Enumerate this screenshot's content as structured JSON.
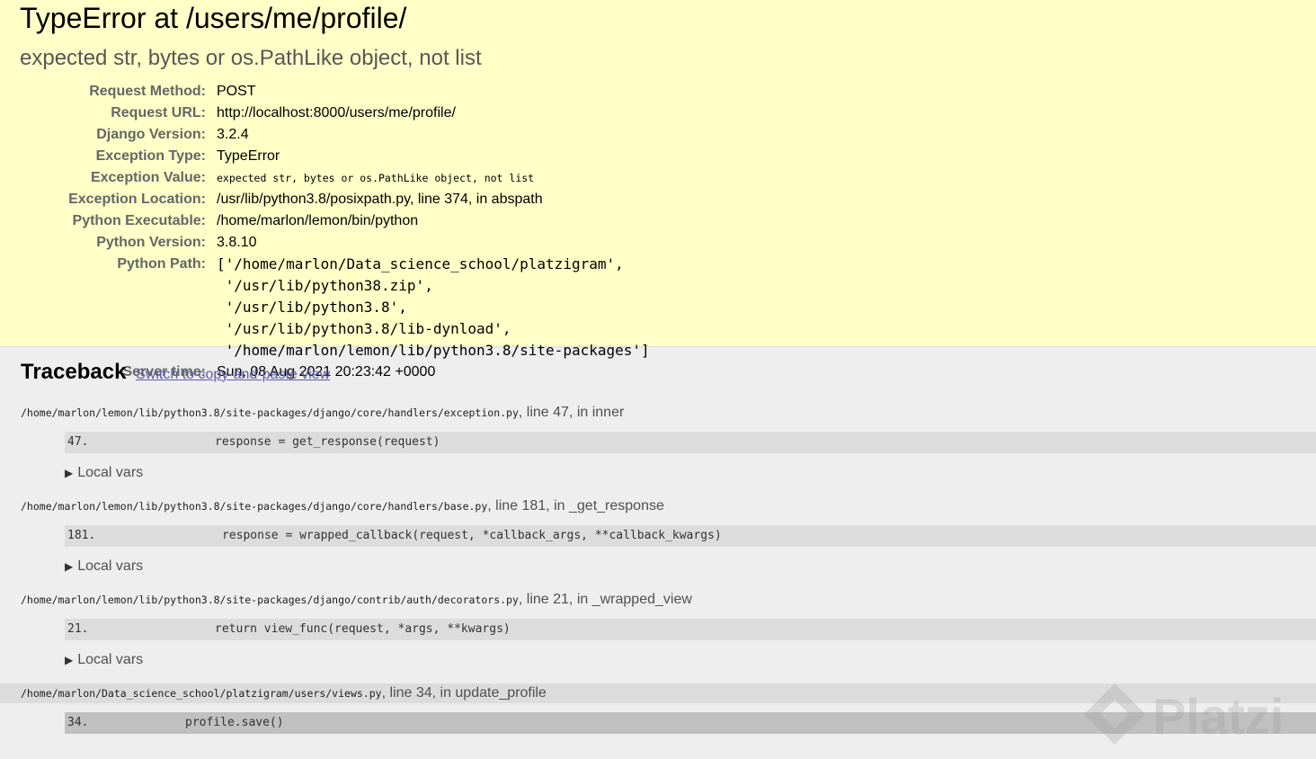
{
  "summary": {
    "title": "TypeError at /users/me/profile/",
    "subtitle": "expected str, bytes or os.PathLike object, not list",
    "meta": [
      {
        "label": "Request Method:",
        "value": "POST"
      },
      {
        "label": "Request URL:",
        "value": "http://localhost:8000/users/me/profile/"
      },
      {
        "label": "Django Version:",
        "value": "3.2.4"
      },
      {
        "label": "Exception Type:",
        "value": "TypeError"
      },
      {
        "label": "Exception Value:",
        "value": "expected str, bytes or os.PathLike object, not list"
      },
      {
        "label": "Exception Location:",
        "value_prefix": "/usr/lib/python3.8/posixpath.py",
        "value_suffix": ", line 374, in abspath"
      },
      {
        "label": "Python Executable:",
        "value": "/home/marlon/lemon/bin/python"
      },
      {
        "label": "Python Version:",
        "value": "3.8.10"
      },
      {
        "label": "Python Path:",
        "value": "['/home/marlon/Data_science_school/platzigram',\n '/usr/lib/python38.zip',\n '/usr/lib/python3.8',\n '/usr/lib/python3.8/lib-dynload',\n '/home/marlon/lemon/lib/python3.8/site-packages']"
      },
      {
        "label": "Server time:",
        "value": "Sun, 08 Aug 2021 20:23:42 +0000"
      }
    ]
  },
  "traceback": {
    "heading": "Traceback",
    "switch_link": "Switch to copy-and-paste view",
    "local_vars_label": "Local vars",
    "frames": [
      {
        "path": "/home/marlon/lemon/lib/python3.8/site-packages/django/core/handlers/exception.py",
        "location": ", line 47, in inner",
        "line_no": "47.",
        "code": "response = get_response(request)"
      },
      {
        "path": "/home/marlon/lemon/lib/python3.8/site-packages/django/core/handlers/base.py",
        "location": ", line 181, in _get_response",
        "line_no": "181.",
        "code": "response = wrapped_callback(request, *callback_args, **callback_kwargs)"
      },
      {
        "path": "/home/marlon/lemon/lib/python3.8/site-packages/django/contrib/auth/decorators.py",
        "location": ", line 21, in _wrapped_view",
        "line_no": "21.",
        "code": "return view_func(request, *args, **kwargs)"
      },
      {
        "path": "/home/marlon/Data_science_school/platzigram/users/views.py",
        "location": ", line 34, in update_profile",
        "line_no": "34.",
        "code": "profile.save()"
      }
    ]
  },
  "watermark": {
    "text": "Platzi"
  }
}
